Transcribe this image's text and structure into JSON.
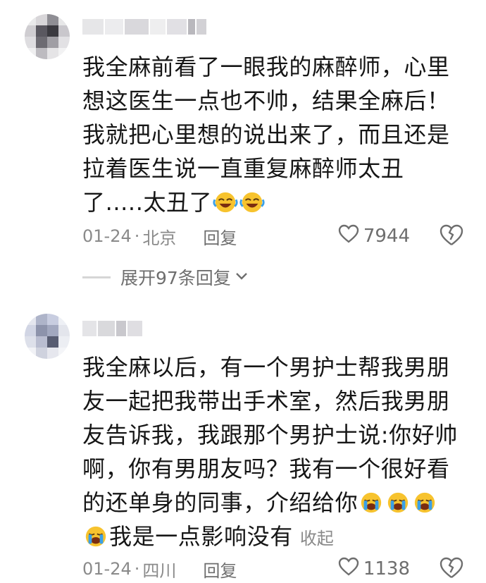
{
  "comments": [
    {
      "text_parts": [
        "我全麻前看了一眼我的麻醉师，心里想这医生一点也不帅，结果全麻后！我就把心里想的说出来了，而且还是拉着医生说一直重复麻醉师太丑了.....太丑了"
      ],
      "trailing_emojis": [
        "rofl-emoji",
        "rofl-emoji"
      ],
      "date": "01-24",
      "separator": "·",
      "location": "北京",
      "reply_label": "回复",
      "like_count": "7944",
      "expand_replies_label": "展开97条回复"
    },
    {
      "text_main": "我全麻以后，有一个男护士帮我男朋友一起把我带出手术室，然后我男朋友告诉我，我跟那个男护士说:你好帅啊，你有男朋友吗？我有一个很好看的还单身的同事，介绍给你",
      "inline_emojis": [
        "sob-emoji",
        "sob-emoji",
        "sob-emoji",
        "sob-emoji"
      ],
      "text_tail": "我是一点影响没有",
      "collapse_label": "收起",
      "date": "01-24",
      "separator": "·",
      "location": "四川",
      "reply_label": "回复",
      "like_count": "1138"
    }
  ],
  "colors": {
    "text": "#161616",
    "meta": "#8a8a8a",
    "icon": "#6e6e6e",
    "emoji_yellow": "#f7c32e",
    "emoji_tear": "#3aa0e8"
  }
}
